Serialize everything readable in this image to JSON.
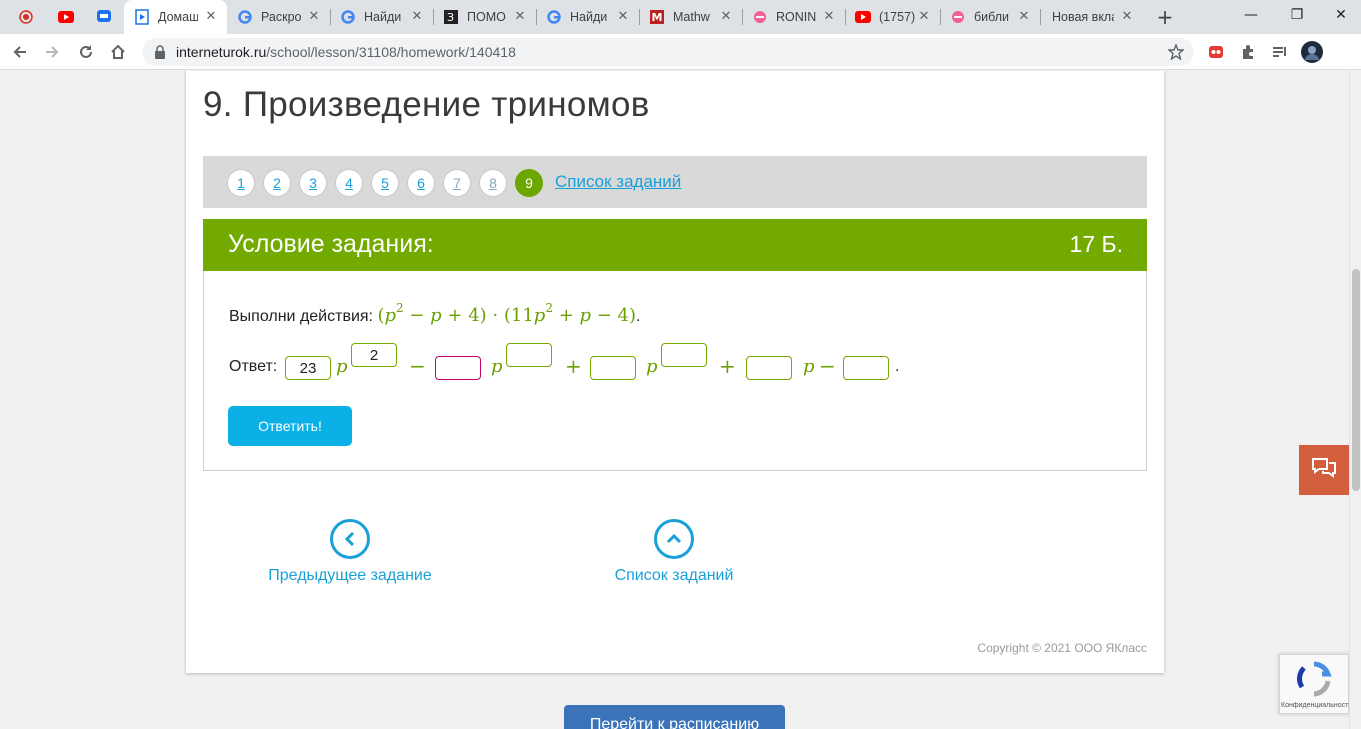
{
  "browser": {
    "tabs": [
      {
        "title": "",
        "icon": "record-icon",
        "color": "#d93025"
      },
      {
        "title": "",
        "icon": "youtube-icon",
        "color": "#ff0000"
      },
      {
        "title": "",
        "icon": "chat-icon",
        "color": "#1a73e8"
      },
      {
        "title": "Домаш",
        "icon": "play-doc-icon",
        "color": "#1a73e8",
        "active": true
      },
      {
        "title": "Раскро",
        "icon": "google-icon"
      },
      {
        "title": "Найди",
        "icon": "google-icon"
      },
      {
        "title": "ПОМО",
        "icon": "z-icon"
      },
      {
        "title": "Найди",
        "icon": "google-icon"
      },
      {
        "title": "Mathw",
        "icon": "m-icon"
      },
      {
        "title": "RONIN",
        "icon": "pink-icon"
      },
      {
        "title": "(1757)",
        "icon": "youtube-icon"
      },
      {
        "title": "библи",
        "icon": "pink-icon"
      },
      {
        "title": "Новая вкла",
        "icon": ""
      }
    ],
    "new_tab": "+",
    "window": {
      "minimize": "—",
      "restore": "❐",
      "close": "✕"
    },
    "url_host": "interneturok.ru",
    "url_path": "/school/lesson/31108/homework/140418"
  },
  "lesson": {
    "title": "9. Произведение триномов",
    "task_numbers": [
      "1",
      "2",
      "3",
      "4",
      "5",
      "6",
      "7",
      "8",
      "9"
    ],
    "current_task": "9",
    "task_list_link": "Список заданий"
  },
  "condition": {
    "header": "Условие задания:",
    "points": "17 Б.",
    "prompt": "Выполни действия:",
    "expression": {
      "open": "(",
      "p": "p",
      "exp": "2",
      "rest1": " − ",
      "rest2": " + 4) · (11",
      "rest3": " + ",
      "rest4": " − 4)",
      "end": "."
    },
    "answer_label": "Ответ:",
    "answers": {
      "coef1": "23",
      "exp1": "2",
      "coef2": "",
      "exp2": "",
      "coef3": "",
      "exp3": "",
      "coef4": "",
      "const": ""
    },
    "symbols": {
      "p": "p",
      "minus": "−",
      "plus": "+",
      "dot": "."
    },
    "submit": "Ответить!"
  },
  "navigation": {
    "prev": "Предыдущее задание",
    "list": "Список заданий"
  },
  "footer": {
    "copyright": "Copyright © 2021 ООО ЯКласс",
    "schedule": "Перейти к расписанию"
  },
  "recaptcha": {
    "label": "Конфиденциальность"
  },
  "colors": {
    "accent_green": "#73aa00",
    "link_blue": "#1aa0d9",
    "button_blue": "#0ab0e6",
    "chat": "#d35e3d"
  }
}
